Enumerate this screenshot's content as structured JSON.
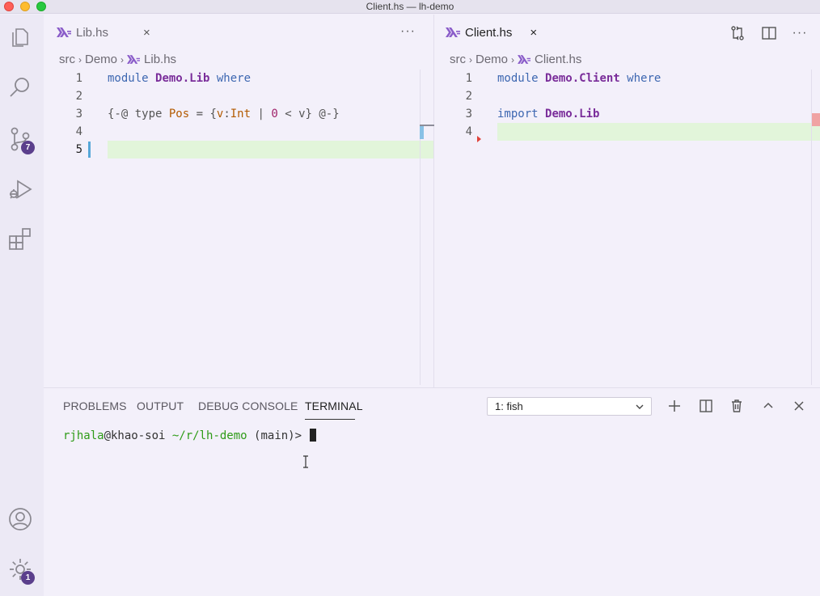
{
  "window": {
    "title": "Client.hs — lh-demo"
  },
  "activity_bar": {
    "items": [
      {
        "name": "explorer",
        "icon": "files-icon"
      },
      {
        "name": "search",
        "icon": "search-icon"
      },
      {
        "name": "source-control",
        "icon": "source-control-icon",
        "badge": "7"
      },
      {
        "name": "run-debug",
        "icon": "run-debug-icon"
      },
      {
        "name": "extensions",
        "icon": "extensions-icon"
      }
    ],
    "bottom": [
      {
        "name": "accounts",
        "icon": "account-icon"
      },
      {
        "name": "manage",
        "icon": "gear-icon",
        "badge": "1"
      }
    ]
  },
  "editor_left": {
    "tab": {
      "label": "Lib.hs",
      "close": "×"
    },
    "more": "···",
    "breadcrumb": [
      "src",
      "Demo",
      "Lib.hs"
    ],
    "lines": [
      {
        "n": "1",
        "tokens": [
          [
            "module ",
            "kw"
          ],
          [
            "Demo.Lib",
            "mod"
          ],
          [
            " where",
            "kw"
          ]
        ]
      },
      {
        "n": "2",
        "tokens": []
      },
      {
        "n": "3",
        "tokens": [
          [
            "{-@ type ",
            "muted"
          ],
          [
            "Pos",
            "ty"
          ],
          [
            " = {",
            "muted"
          ],
          [
            "v",
            "ty"
          ],
          [
            ":",
            "muted"
          ],
          [
            "Int",
            "ty"
          ],
          [
            " | ",
            "muted"
          ],
          [
            "0",
            "num"
          ],
          [
            " < v} @-}",
            "muted"
          ]
        ]
      },
      {
        "n": "4",
        "tokens": []
      },
      {
        "n": "5",
        "tokens": []
      }
    ]
  },
  "editor_right": {
    "tab": {
      "label": "Client.hs",
      "close": "×"
    },
    "more": "···",
    "breadcrumb": [
      "src",
      "Demo",
      "Client.hs"
    ],
    "lines": [
      {
        "n": "1",
        "tokens": [
          [
            "module ",
            "kw"
          ],
          [
            "Demo.Client",
            "mod"
          ],
          [
            " where",
            "kw"
          ]
        ]
      },
      {
        "n": "2",
        "tokens": []
      },
      {
        "n": "3",
        "tokens": [
          [
            "import ",
            "kw"
          ],
          [
            "Demo.Lib",
            "mod"
          ]
        ]
      },
      {
        "n": "4",
        "tokens": []
      }
    ]
  },
  "panel": {
    "tabs": [
      "PROBLEMS",
      "OUTPUT",
      "DEBUG CONSOLE",
      "TERMINAL"
    ],
    "active_tab": "TERMINAL",
    "terminal_select": "1: fish",
    "prompt": {
      "user": "rjhala",
      "host": "@khao-soi",
      "path": "~/r/lh-demo",
      "branch": "(main)>"
    }
  },
  "colors": {
    "accent": "#5b3f8c",
    "added_line": "#e2f5da",
    "modified_gutter": "#56a7d8",
    "haskell_icon": "#8a5cc9"
  }
}
